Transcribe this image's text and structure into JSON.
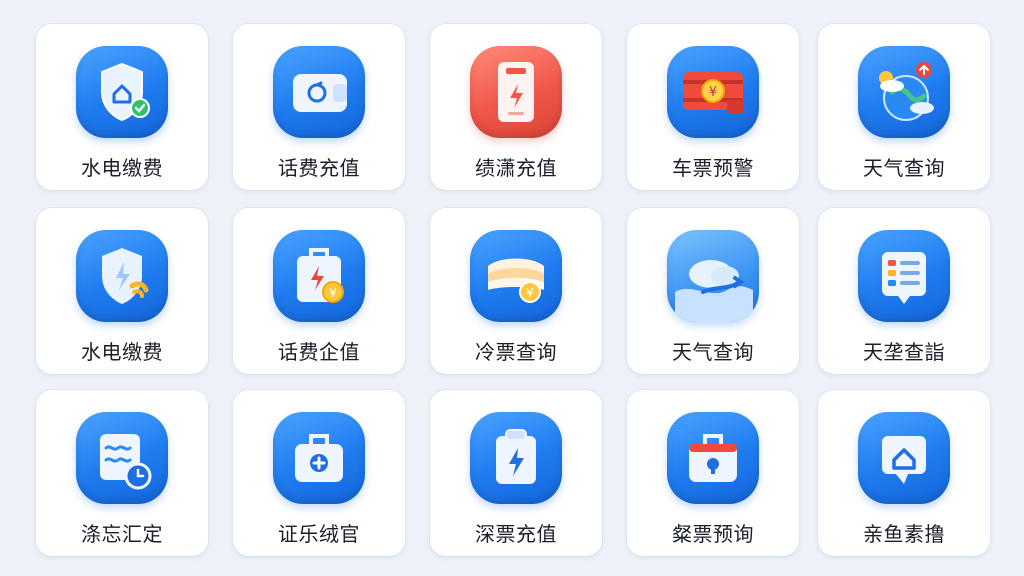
{
  "tiles": [
    {
      "label": "水电缴费",
      "icon": "shield-home-check-icon",
      "bg": "#1f7cf0"
    },
    {
      "label": "话费充值",
      "icon": "wallet-refresh-icon",
      "bg": "#1f7cf0"
    },
    {
      "label": "绩潇充值",
      "icon": "phone-bolt-icon",
      "bg": "#f0574a"
    },
    {
      "label": "车票预警",
      "icon": "ticket-yuan-icon",
      "bg": "#1f7cf0"
    },
    {
      "label": "天气查询",
      "icon": "weather-globe-icon",
      "bg": "#1f7cf0"
    },
    {
      "label": "水电缴费",
      "icon": "shield-bolt-icon",
      "bg": "#1f7cf0"
    },
    {
      "label": "话费企值",
      "icon": "bag-bolt-yuan-icon",
      "bg": "#1f7cf0"
    },
    {
      "label": "冷票查询",
      "icon": "ticket-stack-yuan-icon",
      "bg": "#1f7cf0"
    },
    {
      "label": "天气查询",
      "icon": "cloud-wave-icon",
      "bg": "#1f7cf0"
    },
    {
      "label": "天垄查詣",
      "icon": "list-card-icon",
      "bg": "#1f7cf0"
    },
    {
      "label": "涤忘汇定",
      "icon": "note-clock-icon",
      "bg": "#1f7cf0"
    },
    {
      "label": "证乐绒官",
      "icon": "medical-kit-icon",
      "bg": "#1f7cf0"
    },
    {
      "label": "深票充值",
      "icon": "clipboard-bolt-icon",
      "bg": "#1f7cf0"
    },
    {
      "label": "粲票预询",
      "icon": "bag-lock-icon",
      "bg": "#1f7cf0"
    },
    {
      "label": "亲鱼素撸",
      "icon": "chat-home-icon",
      "bg": "#1f7cf0"
    }
  ]
}
